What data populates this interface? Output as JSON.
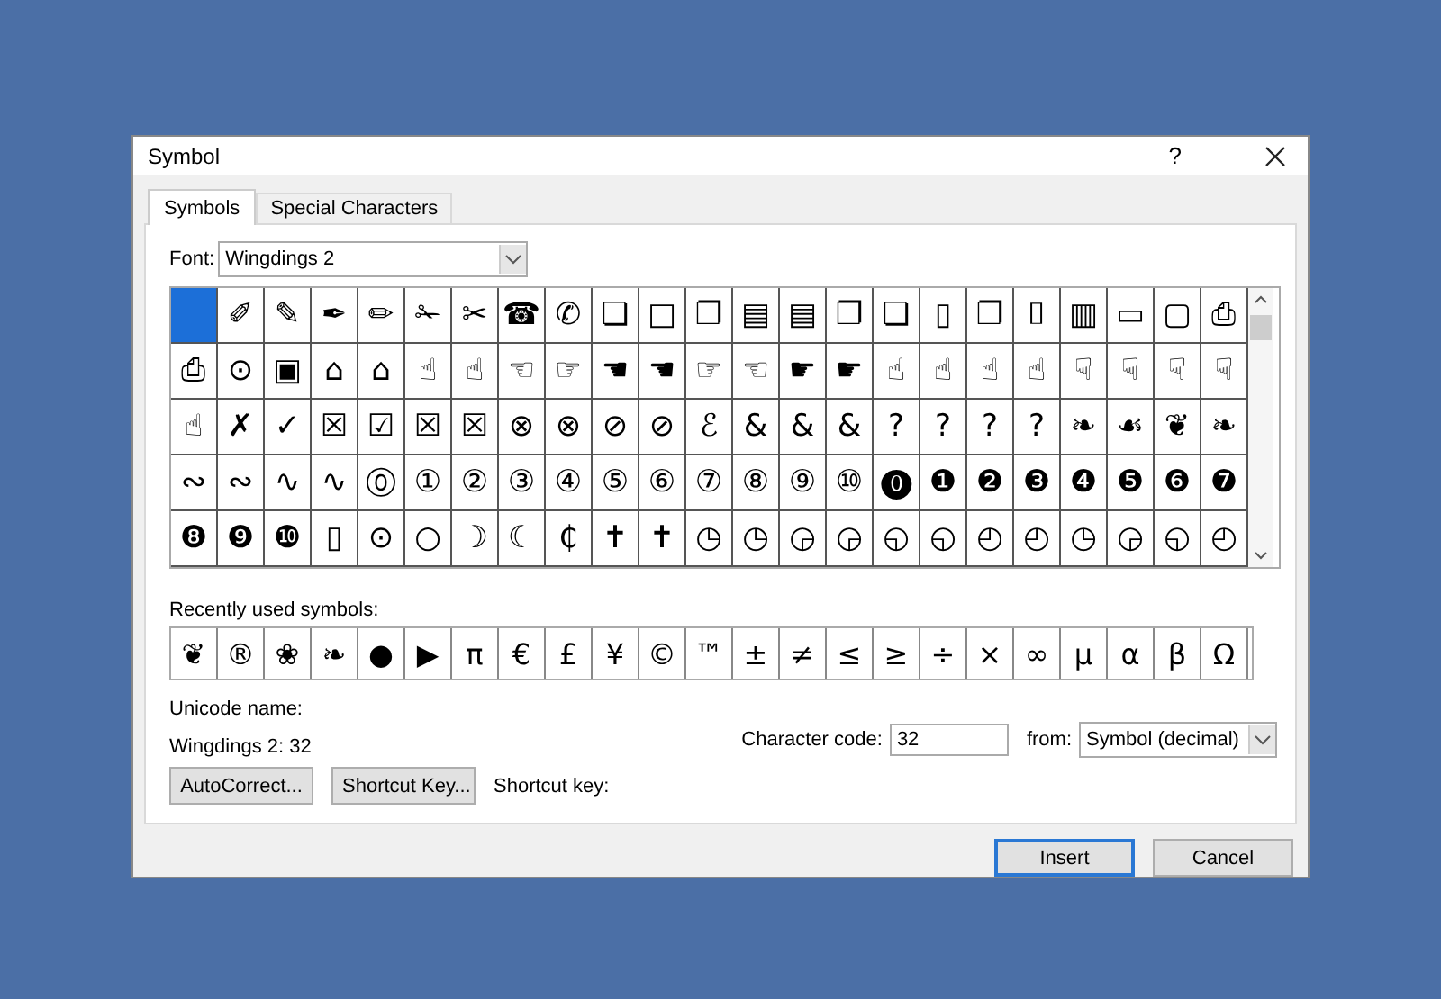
{
  "window": {
    "title": "Symbol",
    "help": "?"
  },
  "tabs": [
    {
      "label": "Symbols",
      "selected": true
    },
    {
      "label": "Special Characters",
      "selected": false
    }
  ],
  "font": {
    "label": "Font:",
    "value": "Wingdings 2"
  },
  "symbol_grid": [
    {
      "cells": [
        {
          "selected": true
        },
        {
          "symbol": "✐",
          "selected": false
        },
        {
          "symbol": "✎",
          "selected": false
        },
        {
          "symbol": "✒",
          "selected": false
        },
        {
          "symbol": "✏",
          "selected": false
        },
        {
          "symbol": "✁",
          "selected": false
        },
        {
          "symbol": "✂",
          "selected": false
        },
        {
          "symbol": "☎",
          "selected": false
        },
        {
          "symbol": "✆",
          "selected": false
        },
        {
          "symbol": "❏",
          "selected": false
        },
        {
          "symbol": "□",
          "selected": false
        },
        {
          "symbol": "❐",
          "selected": false
        },
        {
          "symbol": "▤",
          "selected": false
        },
        {
          "symbol": "▤",
          "selected": false
        },
        {
          "symbol": "❐",
          "selected": false
        },
        {
          "symbol": "❏",
          "selected": false
        },
        {
          "symbol": "▯",
          "selected": false
        },
        {
          "symbol": "❐",
          "selected": false
        },
        {
          "symbol": "⌷",
          "selected": false
        },
        {
          "symbol": "▥",
          "selected": false
        },
        {
          "symbol": "▭",
          "selected": false
        },
        {
          "symbol": "▢",
          "selected": false
        },
        {
          "symbol": "⎙",
          "selected": false
        }
      ]
    },
    {
      "cells": [
        {
          "symbol": "⎙",
          "selected": false
        },
        {
          "symbol": "⊙",
          "selected": false
        },
        {
          "symbol": "▣",
          "selected": false
        },
        {
          "symbol": "⌂",
          "selected": false
        },
        {
          "symbol": "⌂",
          "selected": false
        },
        {
          "symbol": "☝",
          "selected": false
        },
        {
          "symbol": "☝",
          "selected": false
        },
        {
          "symbol": "☜",
          "selected": false
        },
        {
          "symbol": "☞",
          "selected": false
        },
        {
          "symbol": "☚",
          "selected": false
        },
        {
          "symbol": "☚",
          "selected": false
        },
        {
          "symbol": "☞",
          "selected": false
        },
        {
          "symbol": "☜",
          "selected": false
        },
        {
          "symbol": "☛",
          "selected": false
        },
        {
          "symbol": "☛",
          "selected": false
        },
        {
          "symbol": "☝",
          "selected": false
        },
        {
          "symbol": "☝",
          "selected": false
        },
        {
          "symbol": "☝",
          "selected": false
        },
        {
          "symbol": "☝",
          "selected": false
        },
        {
          "symbol": "☟",
          "selected": false
        },
        {
          "symbol": "☟",
          "selected": false
        },
        {
          "symbol": "☟",
          "selected": false
        },
        {
          "symbol": "☟",
          "selected": false
        }
      ]
    },
    {
      "cells": [
        {
          "symbol": "☝",
          "selected": false
        },
        {
          "symbol": "✗",
          "selected": false
        },
        {
          "symbol": "✓",
          "selected": false
        },
        {
          "symbol": "☒",
          "selected": false
        },
        {
          "symbol": "☑",
          "selected": false
        },
        {
          "symbol": "☒",
          "selected": false
        },
        {
          "symbol": "☒",
          "selected": false
        },
        {
          "symbol": "⊗",
          "selected": false
        },
        {
          "symbol": "⊗",
          "selected": false
        },
        {
          "symbol": "⊘",
          "selected": false
        },
        {
          "symbol": "⊘",
          "selected": false
        },
        {
          "symbol": "ℰ",
          "selected": false
        },
        {
          "symbol": "&",
          "selected": false
        },
        {
          "symbol": "&",
          "selected": false
        },
        {
          "symbol": "&",
          "selected": false
        },
        {
          "symbol": "?",
          "selected": false
        },
        {
          "symbol": "?",
          "selected": false
        },
        {
          "symbol": "?",
          "selected": false
        },
        {
          "symbol": "?",
          "selected": false
        },
        {
          "symbol": "❧",
          "selected": false
        },
        {
          "symbol": "☙",
          "selected": false
        },
        {
          "symbol": "❦",
          "selected": false
        },
        {
          "symbol": "❧",
          "selected": false
        }
      ]
    },
    {
      "cells": [
        {
          "symbol": "∾",
          "selected": false
        },
        {
          "symbol": "∾",
          "selected": false
        },
        {
          "symbol": "∿",
          "selected": false
        },
        {
          "symbol": "∿",
          "selected": false
        },
        {
          "symbol": "⓪",
          "selected": false
        },
        {
          "symbol": "①",
          "selected": false
        },
        {
          "symbol": "②",
          "selected": false
        },
        {
          "symbol": "③",
          "selected": false
        },
        {
          "symbol": "④",
          "selected": false
        },
        {
          "symbol": "⑤",
          "selected": false
        },
        {
          "symbol": "⑥",
          "selected": false
        },
        {
          "symbol": "⑦",
          "selected": false
        },
        {
          "symbol": "⑧",
          "selected": false
        },
        {
          "symbol": "⑨",
          "selected": false
        },
        {
          "symbol": "⑩",
          "selected": false
        },
        {
          "symbol": "⓿",
          "selected": false
        },
        {
          "symbol": "❶",
          "selected": false
        },
        {
          "symbol": "❷",
          "selected": false
        },
        {
          "symbol": "❸",
          "selected": false
        },
        {
          "symbol": "❹",
          "selected": false
        },
        {
          "symbol": "❺",
          "selected": false
        },
        {
          "symbol": "❻",
          "selected": false
        },
        {
          "symbol": "❼",
          "selected": false
        }
      ]
    },
    {
      "cells": [
        {
          "symbol": "❽",
          "selected": false
        },
        {
          "symbol": "❾",
          "selected": false
        },
        {
          "symbol": "❿",
          "selected": false
        },
        {
          "symbol": "▯",
          "selected": false
        },
        {
          "symbol": "⊙",
          "selected": false
        },
        {
          "symbol": "○",
          "selected": false
        },
        {
          "symbol": "☽",
          "selected": false
        },
        {
          "symbol": "☾",
          "selected": false
        },
        {
          "symbol": "₵",
          "selected": false
        },
        {
          "symbol": "✝",
          "selected": false
        },
        {
          "symbol": "✝",
          "selected": false
        },
        {
          "symbol": "◷",
          "selected": false
        },
        {
          "symbol": "◷",
          "selected": false
        },
        {
          "symbol": "◶",
          "selected": false
        },
        {
          "symbol": "◶",
          "selected": false
        },
        {
          "symbol": "◵",
          "selected": false
        },
        {
          "symbol": "◵",
          "selected": false
        },
        {
          "symbol": "◴",
          "selected": false
        },
        {
          "symbol": "◴",
          "selected": false
        },
        {
          "symbol": "◷",
          "selected": false
        },
        {
          "symbol": "◶",
          "selected": false
        },
        {
          "symbol": "◵",
          "selected": false
        },
        {
          "symbol": "◴",
          "selected": false
        }
      ]
    }
  ],
  "recent": {
    "label": "Recently used symbols:",
    "symbols": [
      "❦",
      "®",
      "❀",
      "❧",
      "●",
      "▶",
      "π",
      "€",
      "£",
      "¥",
      "©",
      "™",
      "±",
      "≠",
      "≤",
      "≥",
      "÷",
      "×",
      "∞",
      "µ",
      "α",
      "β",
      "Ω"
    ]
  },
  "unicode_name": {
    "label": "Unicode name:",
    "value": "Wingdings 2: 32"
  },
  "character_code": {
    "label": "Character code:",
    "value": "32"
  },
  "from": {
    "label": "from:",
    "value": "Symbol (decimal)"
  },
  "autocorrect_button": "AutoCorrect...",
  "shortcut_key_button": "Shortcut Key...",
  "shortcut_key_label": "Shortcut key:",
  "footer_buttons": [
    {
      "label": "Insert",
      "default": true
    },
    {
      "label": "Cancel",
      "default": false
    }
  ]
}
